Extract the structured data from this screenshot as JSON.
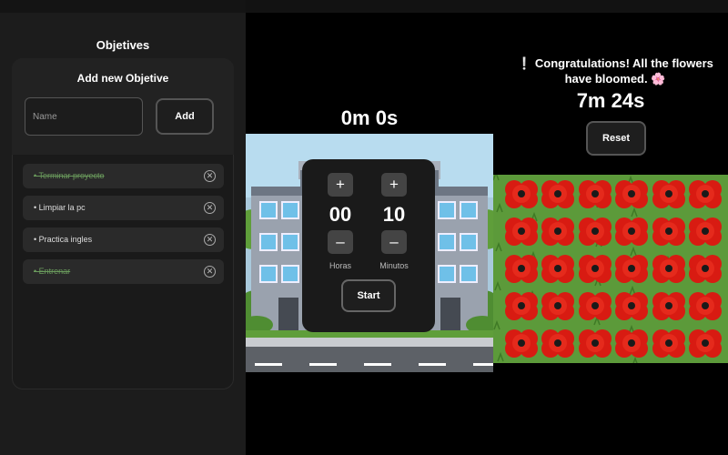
{
  "objectives": {
    "title": "Objetives",
    "add_title": "Add new Objetive",
    "name_placeholder": "Name",
    "name_value": "",
    "add_label": "Add",
    "items": [
      {
        "text": "• Terminar proyecto",
        "done": true
      },
      {
        "text": "• Limpiar la pc",
        "done": false
      },
      {
        "text": "• Practica ingles",
        "done": false
      },
      {
        "text": "• Entrenar",
        "done": true
      }
    ],
    "remove_icon": "circle-x-icon",
    "done_color": "#6a9a5c"
  },
  "timer": {
    "display": "0m 0s",
    "hours": "00",
    "minutes": "10",
    "hours_label": "Horas",
    "minutes_label": "Minutos",
    "plus": "+",
    "minus": "–",
    "start_label": "Start"
  },
  "garden": {
    "message": "❕ Congratulations! All the flowers have bloomed. 🌸",
    "elapsed": "7m 24s",
    "reset_label": "Reset",
    "flower_icon": "poppy-flower-icon",
    "grass_color": "#5c9a3a",
    "flower_color": "#d81b12"
  }
}
